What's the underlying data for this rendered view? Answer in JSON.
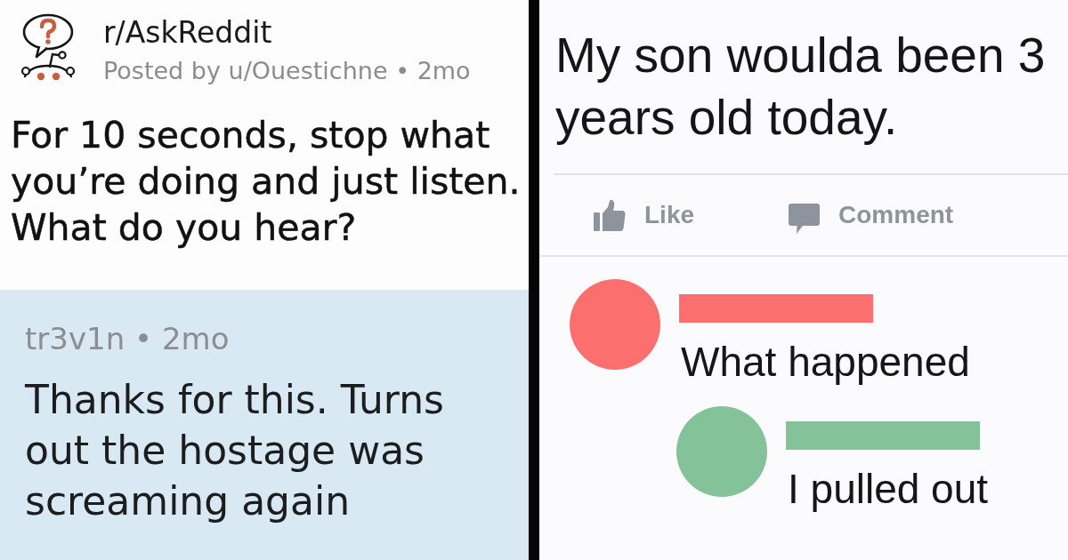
{
  "left_post": {
    "subreddit": "r/AskReddit",
    "byline": "Posted by u/Ouestichne • 2mo",
    "title": "For 10 seconds, stop what you’re doing and just listen. What do you hear?",
    "reply": {
      "byline": "tr3v1n • 2mo",
      "text": "Thanks for this. Turns out the hostage was screaming again"
    }
  },
  "right_post": {
    "text": "My son woulda been 3 years old today.",
    "actions": [
      {
        "kind": "like",
        "label": "Like"
      },
      {
        "kind": "comment",
        "label": "Comment"
      }
    ],
    "comments": [
      {
        "color": "#fb6f6f",
        "text": "What happened",
        "replies": [
          {
            "color": "#84c299",
            "text": "I pulled out"
          }
        ]
      }
    ]
  }
}
